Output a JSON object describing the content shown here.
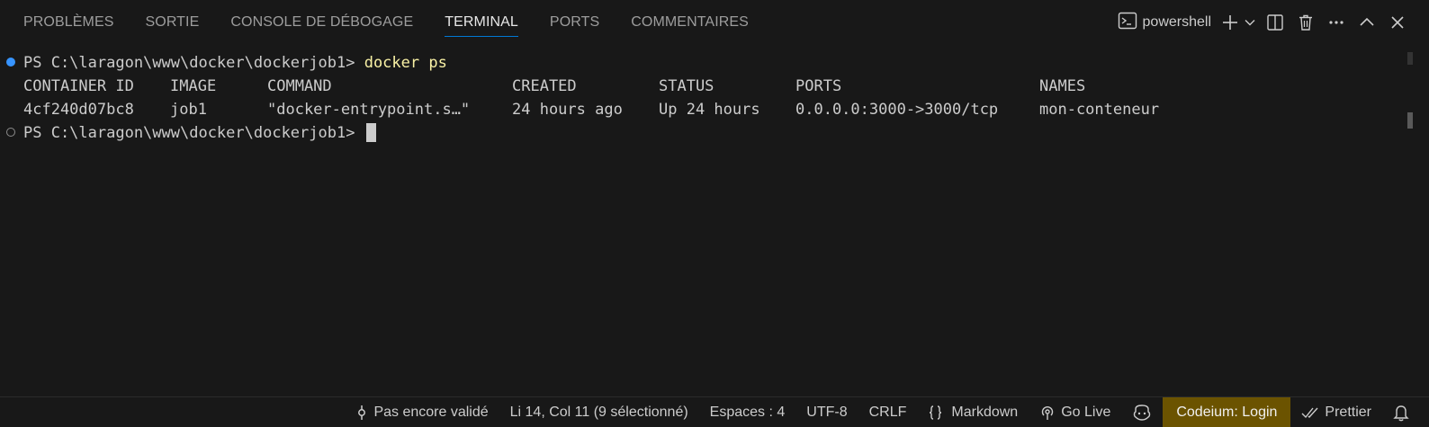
{
  "panel": {
    "tabs": [
      {
        "label": "PROBLÈMES",
        "active": false
      },
      {
        "label": "SORTIE",
        "active": false
      },
      {
        "label": "CONSOLE DE DÉBOGAGE",
        "active": false
      },
      {
        "label": "TERMINAL",
        "active": true
      },
      {
        "label": "PORTS",
        "active": false
      },
      {
        "label": "COMMENTAIRES",
        "active": false
      }
    ],
    "shell": "powershell",
    "actions": [
      "terminal-icon",
      "add-icon",
      "chevron-down-icon",
      "split-icon",
      "trash-icon",
      "more-icon",
      "maximize-icon",
      "close-icon"
    ]
  },
  "terminal": {
    "prompt": "PS C:\\laragon\\www\\docker\\dockerjob1> ",
    "command": "docker ps",
    "headers": [
      "CONTAINER ID",
      "IMAGE",
      "COMMAND",
      "CREATED",
      "STATUS",
      "PORTS",
      "NAMES"
    ],
    "rows": [
      [
        "4cf240d07bc8",
        "job1",
        "\"docker-entrypoint.s…\"",
        "24 hours ago",
        "Up 24 hours",
        "0.0.0.0:3000->3000/tcp",
        "mon-conteneur"
      ]
    ],
    "prompt2": "PS C:\\laragon\\www\\docker\\dockerjob1> "
  },
  "statusbar": {
    "validation": "Pas encore validé",
    "position": "Li 14, Col 11 (9 sélectionné)",
    "spaces": "Espaces : 4",
    "encoding": "UTF-8",
    "eol": "CRLF",
    "language": "Markdown",
    "golive": "Go Live",
    "codeium": "Codeium: Login",
    "prettier": "Prettier"
  },
  "colors": {
    "background": "#181818",
    "accent": "#0078d4",
    "command": "#f9f1a5",
    "codeium_bg": "#6b5300"
  }
}
